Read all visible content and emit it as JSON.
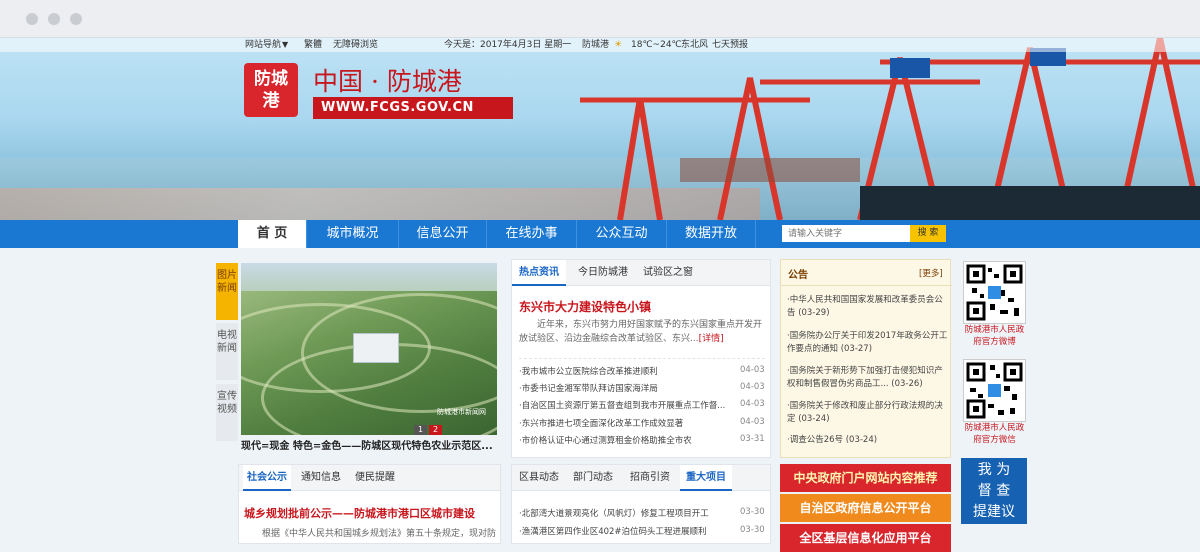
{
  "topbar": {
    "site_nav": "网站导航",
    "traditional": "繁體",
    "accessible": "无障碍浏览",
    "date": "今天是：2017年4月3日 星期一",
    "city": "防城港",
    "temp": "18℃~24℃",
    "wind": "东北风",
    "forecast": "七天预报"
  },
  "header": {
    "logo_line1": "防城",
    "logo_line2": "港",
    "title": "中国 · 防城港",
    "url": "WWW.FCGS.GOV.CN"
  },
  "nav": {
    "items": [
      "首 页",
      "城市概况",
      "信息公开",
      "在线办事",
      "公众互动",
      "数据开放"
    ],
    "search_placeholder": "请输入关键字",
    "search_button": "搜 索"
  },
  "sidetabs": [
    "图片新闻",
    "电视新闻",
    "宣传视频"
  ],
  "photo": {
    "caption": "现代=现金 特色=金色——防城区现代特色农业示范区...",
    "pages": [
      "1",
      "2"
    ],
    "watermark": "防城港市新闻网"
  },
  "hot": {
    "tabs": [
      "热点资讯",
      "今日防城港",
      "试验区之窗"
    ],
    "headline": "东兴市大力建设特色小镇",
    "summary": "近年来，东兴市努力用好国家赋予的东兴国家重点开发开放试验区、沿边金融综合改革试验区、东兴...",
    "more": "[详情]",
    "items": [
      {
        "title": "·我市城市公立医院综合改革推进顺利",
        "date": "04-03"
      },
      {
        "title": "·市委书记金湘军带队拜访国家海洋局",
        "date": "04-03"
      },
      {
        "title": "·自治区国土资源厅第五督查组到我市开展重点工作督...",
        "date": "04-03"
      },
      {
        "title": "·东兴市推进七项全面深化改革工作成效显著",
        "date": "04-03"
      },
      {
        "title": "·市价格认证中心通过测算租金价格助推全市农",
        "date": "03-31"
      }
    ]
  },
  "notice": {
    "title": "公告",
    "more": "[更多]",
    "items": [
      "·中华人民共和国国家发展和改革委员会公告 (03-29)",
      "·国务院办公厅关于印发2017年政务公开工作要点的通知 (03-27)",
      "·国务院关于新形势下加强打击侵犯知识产权和制售假冒伪劣商品工... (03-26)",
      "·国务院关于修改和废止部分行政法规的决定 (03-24)",
      "·调查公告26号 (03-24)"
    ]
  },
  "qr": {
    "weibo": "防城港市人民政府官方微博",
    "weixin": "防城港市人民政府官方微信"
  },
  "public": {
    "tabs": [
      "社会公示",
      "通知信息",
      "便民提醒"
    ],
    "headline": "城乡规划批前公示——防城港市港口区城市建设",
    "summary": "根据《中华人民共和国城乡规划法》第五十条规定，现对防城"
  },
  "county": {
    "tabs": [
      "区县动态",
      "部门动态",
      "招商引资",
      "重大项目"
    ],
    "items": [
      {
        "title": "·北部湾大道景观亮化（风帆灯）修复工程项目开工",
        "date": "03-30"
      },
      {
        "title": "·渔澫港区第四作业区402#泊位码头工程进展顺利",
        "date": "03-30"
      }
    ]
  },
  "banners": [
    "中央政府门户网站内容推荐",
    "自治区政府信息公开平台",
    "全区基层信息化应用平台"
  ],
  "supervise": [
    "我 为",
    "督 查",
    "提建议"
  ],
  "colors": {
    "nav_blue": "#1a78d2",
    "brand_red": "#c8161d",
    "accent_yellow": "#f7c300"
  }
}
